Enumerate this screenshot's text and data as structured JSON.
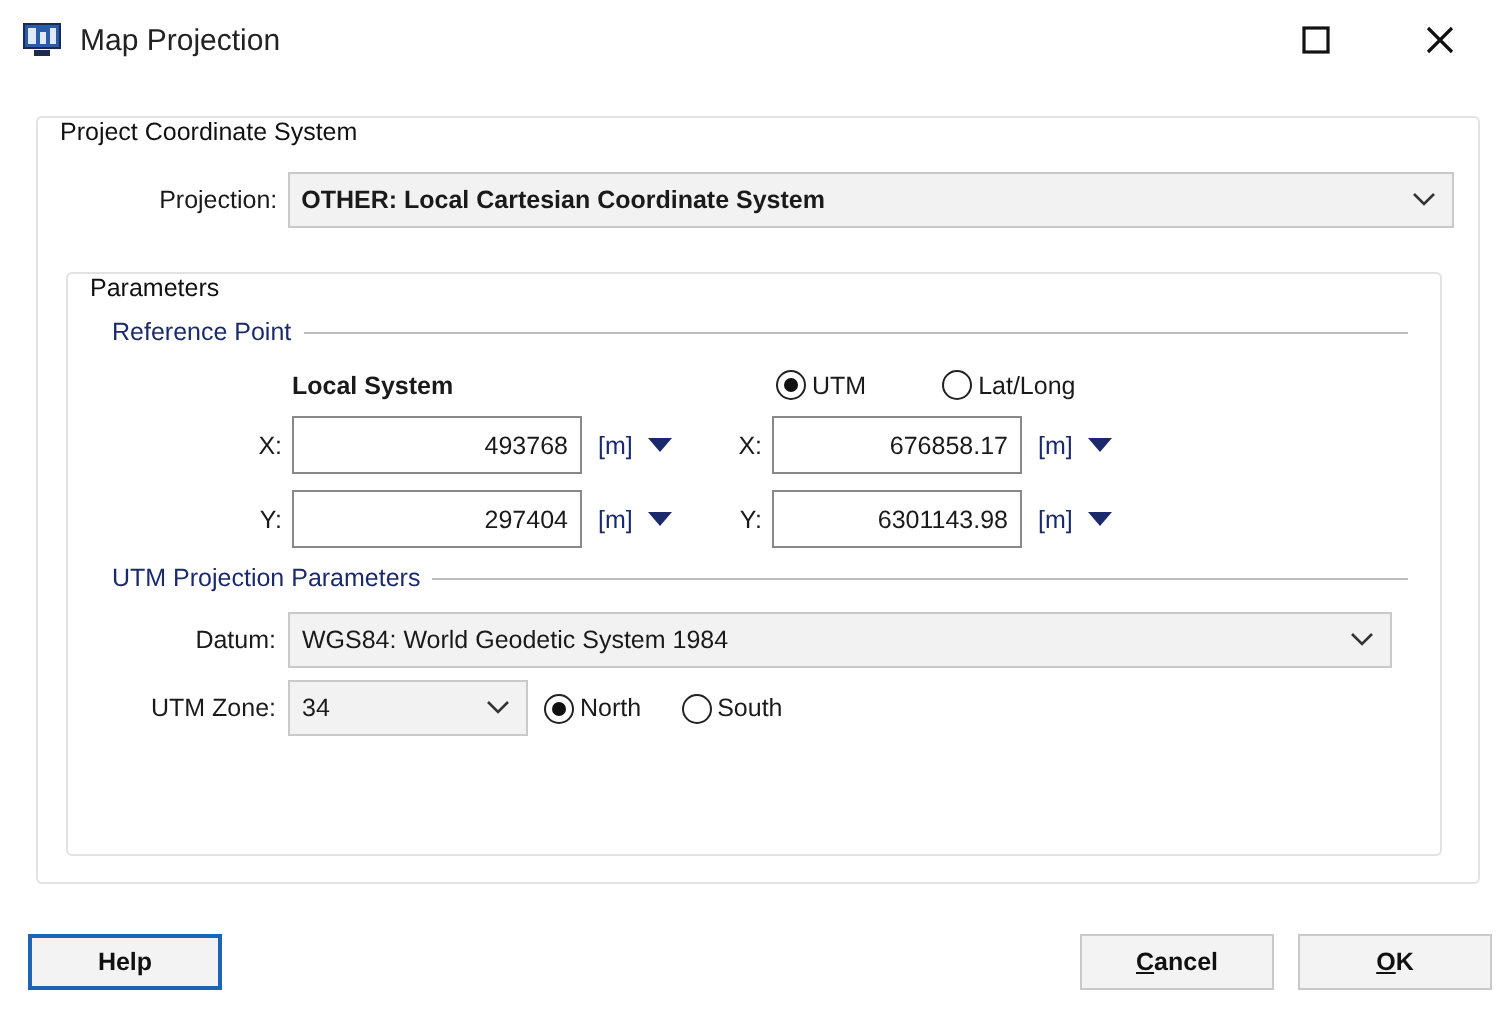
{
  "window": {
    "title": "Map Projection"
  },
  "project_coordinate_system": {
    "title": "Project Coordinate System",
    "projection": {
      "label": "Projection:",
      "value": "OTHER: Local Cartesian Coordinate System"
    },
    "parameters": {
      "title": "Parameters",
      "reference_point": {
        "title": "Reference Point",
        "local_title": "Local System",
        "modes": [
          {
            "label": "UTM",
            "selected": true
          },
          {
            "label": "Lat/Long",
            "selected": false
          }
        ],
        "rows": [
          {
            "label_local": "X:",
            "local": "493768",
            "unit_local": "[m]",
            "label_utm": "X:",
            "utm": "676858.17",
            "unit_utm": "[m]"
          },
          {
            "label_local": "Y:",
            "local": "297404",
            "unit_local": "[m]",
            "label_utm": "Y:",
            "utm": "6301143.98",
            "unit_utm": "[m]"
          }
        ]
      },
      "utm_projection": {
        "title": "UTM Projection Parameters",
        "datum": {
          "label": "Datum:",
          "value": "WGS84: World Geodetic System 1984"
        },
        "zone": {
          "label": "UTM Zone:",
          "value": "34"
        },
        "hemisphere": [
          {
            "label": "North",
            "selected": true
          },
          {
            "label": "South",
            "selected": false
          }
        ]
      }
    }
  },
  "buttons": [
    {
      "label": "Help",
      "kind": "left",
      "focused": true
    },
    {
      "label": "Cancel",
      "kind": "right",
      "focused": false
    },
    {
      "label": "OK",
      "kind": "right",
      "focused": false
    }
  ]
}
